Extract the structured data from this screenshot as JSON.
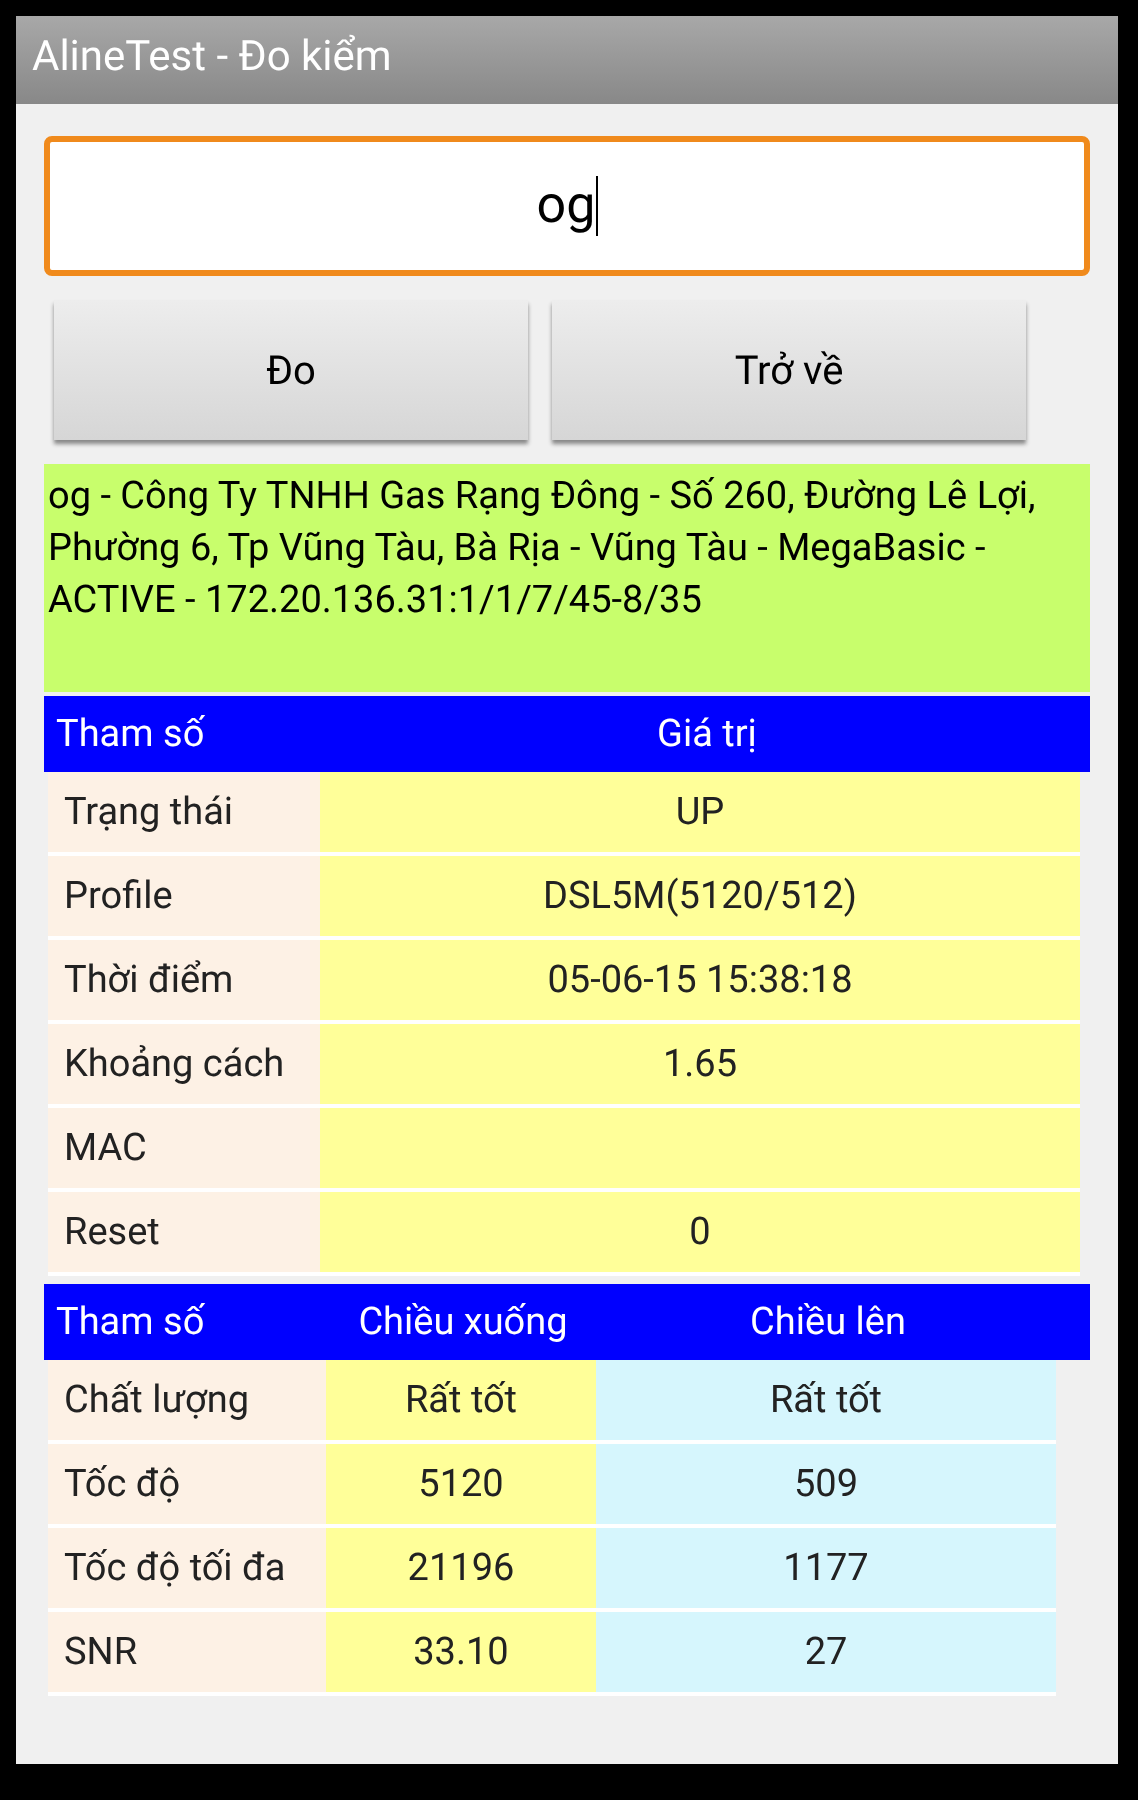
{
  "window": {
    "title": "AlineTest - Đo kiểm"
  },
  "search": {
    "value": "og",
    "focused": true
  },
  "buttons": [
    "Đo",
    "Trở về"
  ],
  "info": "og - Công Ty TNHH Gas Rạng Đông - Số 260, Đường Lê Lợi, Phường 6, Tp Vũng Tàu, Bà Rịa - Vũng Tàu - MegaBasic - ACTIVE - 172.20.136.31:1/1/7/45-8/35",
  "table1": {
    "columns": [
      "Tham số",
      "Giá trị"
    ],
    "rows": [
      [
        "Trạng thái",
        "UP"
      ],
      [
        "Profile",
        "DSL5M(5120/512)"
      ],
      [
        "Thời điểm",
        "05-06-15 15:38:18"
      ],
      [
        "Khoảng cách",
        "1.65"
      ],
      [
        "MAC",
        ""
      ],
      [
        "Reset",
        "0"
      ]
    ]
  },
  "table2": {
    "columns": [
      "Tham số",
      "Chiều xuống",
      "Chiều lên"
    ],
    "rows": [
      [
        "Chất lượng",
        "Rất tốt",
        "Rất tốt"
      ],
      [
        "Tốc độ",
        "5120",
        "509"
      ],
      [
        "Tốc độ tối đa",
        "21196",
        "1177"
      ],
      [
        "SNR",
        "33.10",
        "27"
      ]
    ]
  }
}
